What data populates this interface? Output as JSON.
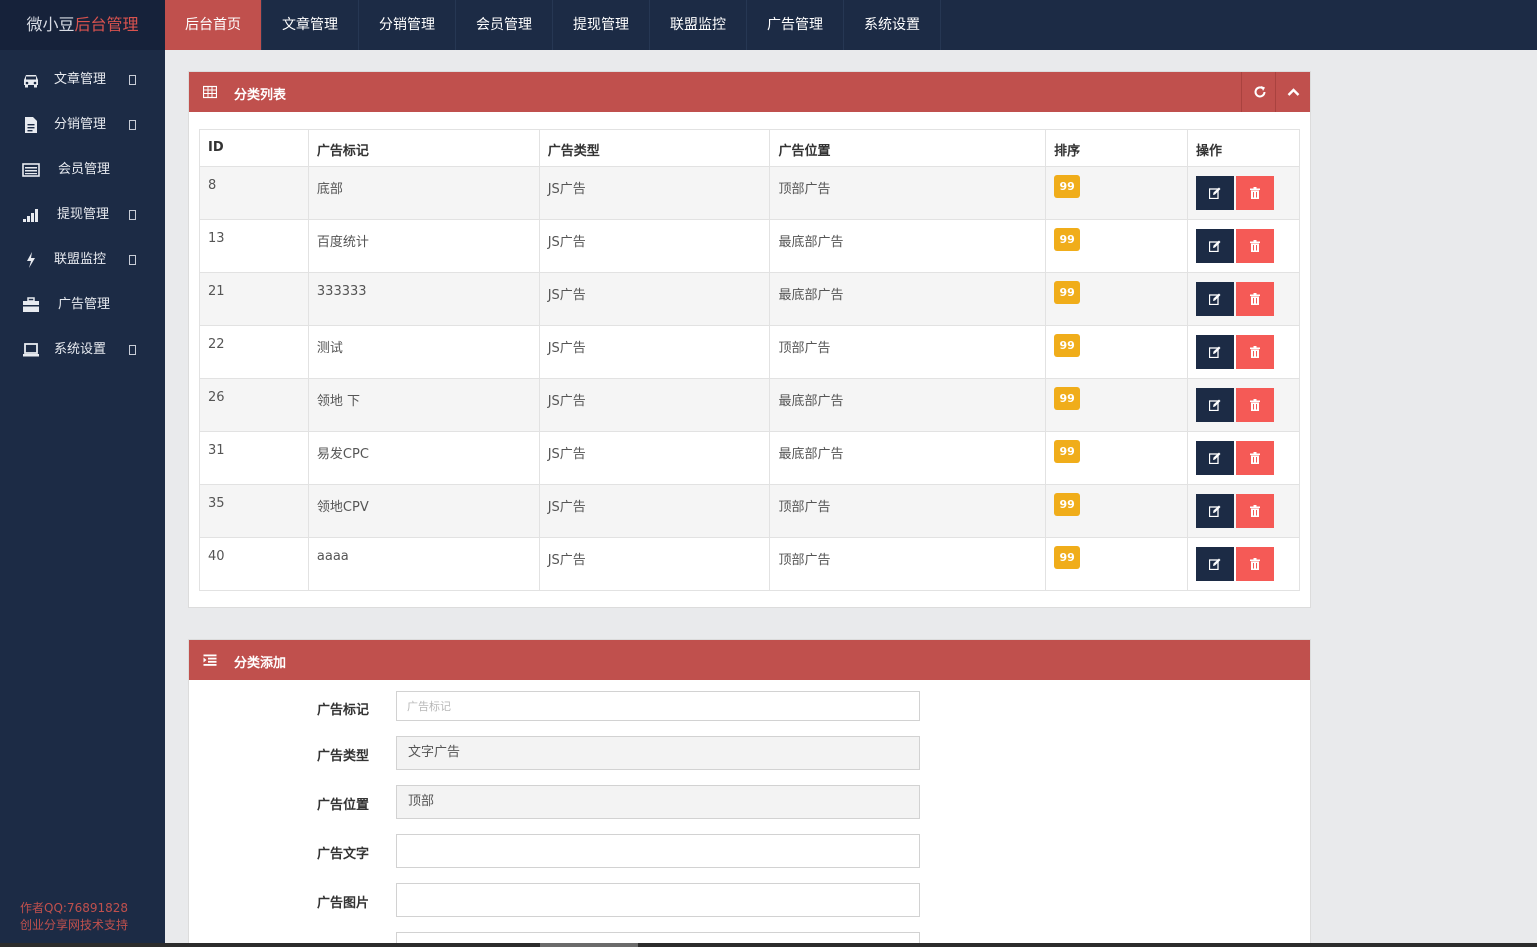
{
  "brand": {
    "part1": "微小豆",
    "part2": "后台管理"
  },
  "topnav": [
    "后台首页",
    "文章管理",
    "分销管理",
    "会员管理",
    "提现管理",
    "联盟监控",
    "广告管理",
    "系统设置"
  ],
  "sidebar": {
    "items": [
      {
        "label": "文章管理",
        "icon": "car-icon",
        "has_arrow": true
      },
      {
        "label": "分销管理",
        "icon": "file-icon",
        "has_arrow": true
      },
      {
        "label": "会员管理",
        "icon": "list-icon",
        "has_arrow": false
      },
      {
        "label": "提现管理",
        "icon": "signal-icon",
        "has_arrow": true
      },
      {
        "label": "联盟监控",
        "icon": "bolt-icon",
        "has_arrow": true
      },
      {
        "label": "广告管理",
        "icon": "briefcase-icon",
        "has_arrow": false
      },
      {
        "label": "系统设置",
        "icon": "laptop-icon",
        "has_arrow": true
      }
    ],
    "footer_line1": "作者QQ:76891828",
    "footer_line2": "创业分享网技术支持"
  },
  "list_panel": {
    "title": "分类列表",
    "columns": [
      "ID",
      "广告标记",
      "广告类型",
      "广告位置",
      "排序",
      "操作"
    ],
    "rows": [
      {
        "id": "8",
        "mark": "底部",
        "type": "JS广告",
        "position": "顶部广告",
        "sort": "99"
      },
      {
        "id": "13",
        "mark": "百度统计",
        "type": "JS广告",
        "position": "最底部广告",
        "sort": "99"
      },
      {
        "id": "21",
        "mark": "333333",
        "type": "JS广告",
        "position": "最底部广告",
        "sort": "99"
      },
      {
        "id": "22",
        "mark": "测试",
        "type": "JS广告",
        "position": "顶部广告",
        "sort": "99"
      },
      {
        "id": "26",
        "mark": "领地 下",
        "type": "JS广告",
        "position": "最底部广告",
        "sort": "99"
      },
      {
        "id": "31",
        "mark": "易发CPC",
        "type": "JS广告",
        "position": "最底部广告",
        "sort": "99"
      },
      {
        "id": "35",
        "mark": "领地CPV",
        "type": "JS广告",
        "position": "顶部广告",
        "sort": "99"
      },
      {
        "id": "40",
        "mark": "aaaa",
        "type": "JS广告",
        "position": "顶部广告",
        "sort": "99"
      }
    ]
  },
  "add_panel": {
    "title": "分类添加",
    "fields": {
      "mark_label": "广告标记",
      "mark_placeholder": "广告标记",
      "type_label": "广告类型",
      "type_value": "文字广告",
      "position_label": "广告位置",
      "position_value": "顶部",
      "text_label": "广告文字",
      "image_label": "广告图片"
    }
  },
  "colors": {
    "accent": "#c0504d",
    "navy": "#1c2b45",
    "badge": "#f0ad1a",
    "danger": "#f55a56"
  }
}
